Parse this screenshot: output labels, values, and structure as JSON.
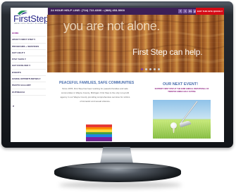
{
  "colors": {
    "topbar": "#3d1f57",
    "exit_button": "#d50b16",
    "heading_blue": "#4d70ae",
    "event_subtitle": "#8c1c7f",
    "nav_active": "#8d1f8f"
  },
  "header": {
    "help_line": "24 HOUR HELP LINE: (734) 722-6800 • (888) 453-5900",
    "social": [
      "f",
      "t",
      "in",
      "yt"
    ],
    "exit_button": "EXIT THIS SITE QUICKLY"
  },
  "logo": {
    "name": "FirstStep",
    "subtitle": "WAYNE COUNTY PROJECT ON DOMESTIC ASSAULT"
  },
  "sidebar": {
    "items": [
      {
        "label": "HOME",
        "active": true
      },
      {
        "label": "ABOUT FIRST STEP ▾",
        "active": false
      },
      {
        "label": "PROGRAMS + SERVICES",
        "active": false
      },
      {
        "label": "GET HELP ▾",
        "active": false
      },
      {
        "label": "STAY SAFE ▾",
        "active": false
      },
      {
        "label": "GET INVOLVED ▾",
        "active": false
      },
      {
        "label": "EVENTS",
        "active": false
      },
      {
        "label": "GIVING OPPORTUNITIES ▾",
        "active": false
      },
      {
        "label": "PHOTO GALLERY",
        "active": false
      },
      {
        "label": "OUTREACH",
        "active": false
      }
    ],
    "search_icon": "search-icon"
  },
  "hero": {
    "heading": "you are not alone.",
    "tagline": "First Step can help."
  },
  "main": {
    "peace_title": "PEACEFUL FAMILIES, SAFE COMMUNITIES",
    "peace_body": "Since 1978, First Step has been working for peaceful families and safe communities in Wayne County, Michigan. First Step is the only non-profit agency in our Wayne County providing comprehensive services for victims of domestic and sexual violence.",
    "event_title": "OUR NEXT EVENT!",
    "event_subtitle": "SUPPORT FIRST STEP AT THE 32ND ANNUAL INVITATIONAL OF TRENTON ANNEX GOLF OUTING",
    "rainbow_colors": [
      "#e53935",
      "#fb8c00",
      "#fdd835",
      "#43a047",
      "#1e88e5",
      "#7b1fa2"
    ],
    "golf_image": "golf-image"
  }
}
